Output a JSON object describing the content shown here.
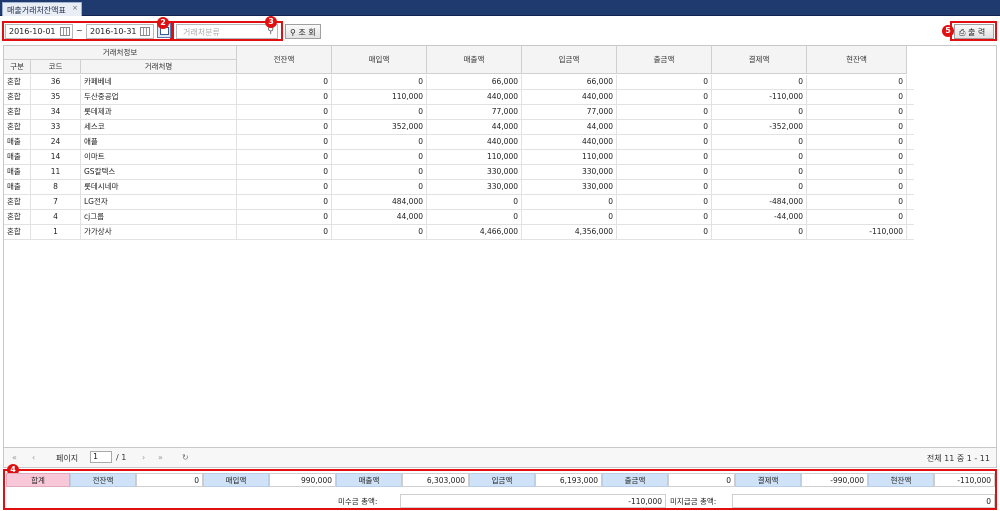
{
  "tab": {
    "title": "매출거래처잔액표",
    "close": "×"
  },
  "filters": {
    "date_from": "2016-10-01",
    "separator": "~",
    "date_to": "2016-10-31",
    "search_placeholder": "거래처분류",
    "search_button": "조 회",
    "print_button": "출 력"
  },
  "badges": [
    "2",
    "3",
    "4",
    "5"
  ],
  "columns": {
    "group": "거래처정보",
    "type": "구분",
    "code": "코드",
    "name": "거래처명",
    "prev": "전잔액",
    "buy": "매입액",
    "sell": "매출액",
    "deposit": "입금액",
    "withdraw": "출금액",
    "settle": "결제액",
    "current": "현잔액"
  },
  "rows": [
    [
      "혼합",
      "36",
      "카페베네",
      "0",
      "0",
      "66,000",
      "66,000",
      "0",
      "0",
      "0"
    ],
    [
      "혼합",
      "35",
      "두산중공업",
      "0",
      "110,000",
      "440,000",
      "440,000",
      "0",
      "-110,000",
      "0"
    ],
    [
      "혼합",
      "34",
      "롯데제과",
      "0",
      "0",
      "77,000",
      "77,000",
      "0",
      "0",
      "0"
    ],
    [
      "혼합",
      "33",
      "세스코",
      "0",
      "352,000",
      "44,000",
      "44,000",
      "0",
      "-352,000",
      "0"
    ],
    [
      "매출",
      "24",
      "애플",
      "0",
      "0",
      "440,000",
      "440,000",
      "0",
      "0",
      "0"
    ],
    [
      "매출",
      "14",
      "이마트",
      "0",
      "0",
      "110,000",
      "110,000",
      "0",
      "0",
      "0"
    ],
    [
      "매출",
      "11",
      "GS칼텍스",
      "0",
      "0",
      "330,000",
      "330,000",
      "0",
      "0",
      "0"
    ],
    [
      "매출",
      "8",
      "롯데시네마",
      "0",
      "0",
      "330,000",
      "330,000",
      "0",
      "0",
      "0"
    ],
    [
      "혼합",
      "7",
      "LG전자",
      "0",
      "484,000",
      "0",
      "0",
      "0",
      "-484,000",
      "0"
    ],
    [
      "혼합",
      "4",
      "cj그룹",
      "0",
      "44,000",
      "0",
      "0",
      "0",
      "-44,000",
      "0"
    ],
    [
      "혼합",
      "1",
      "가가상사",
      "0",
      "0",
      "4,466,000",
      "4,356,000",
      "0",
      "0",
      "-110,000"
    ]
  ],
  "pager": {
    "page_label": "페이지",
    "page": "1",
    "of": "/ 1",
    "total": "전체 11 중 1 - 11"
  },
  "summary": {
    "total_label": "합계",
    "items": [
      {
        "label": "전잔액",
        "value": "0"
      },
      {
        "label": "매입액",
        "value": "990,000"
      },
      {
        "label": "매출액",
        "value": "6,303,000"
      },
      {
        "label": "입금액",
        "value": "6,193,000"
      },
      {
        "label": "출금액",
        "value": "0"
      },
      {
        "label": "결제액",
        "value": "-990,000"
      },
      {
        "label": "현잔액",
        "value": "-110,000"
      }
    ],
    "receivable_label": "미수금 총액:",
    "receivable_value": "-110,000",
    "unpaid_label": "미지급금 총액:",
    "unpaid_value": "0"
  }
}
